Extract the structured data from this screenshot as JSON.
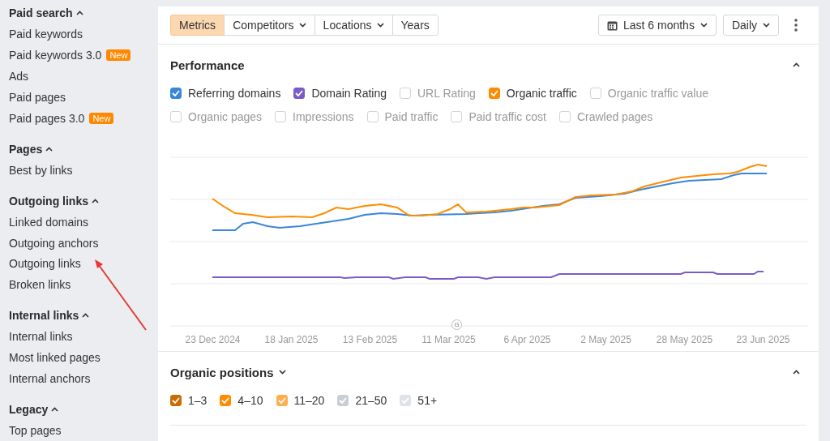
{
  "sidebar": {
    "sections": [
      {
        "title": "Paid search",
        "expanded": true,
        "items": [
          {
            "label": "Paid keywords"
          },
          {
            "label": "Paid keywords 3.0",
            "badge": "New"
          },
          {
            "label": "Ads"
          },
          {
            "label": "Paid pages"
          },
          {
            "label": "Paid pages 3.0",
            "badge": "New"
          }
        ]
      },
      {
        "title": "Pages",
        "expanded": true,
        "items": [
          {
            "label": "Best by links"
          }
        ]
      },
      {
        "title": "Outgoing links",
        "expanded": true,
        "items": [
          {
            "label": "Linked domains"
          },
          {
            "label": "Outgoing anchors"
          },
          {
            "label": "Outgoing links"
          },
          {
            "label": "Broken links"
          }
        ]
      },
      {
        "title": "Internal links",
        "expanded": true,
        "items": [
          {
            "label": "Internal links"
          },
          {
            "label": "Most linked pages"
          },
          {
            "label": "Internal anchors"
          }
        ]
      },
      {
        "title": "Legacy",
        "expanded": true,
        "items": [
          {
            "label": "Top pages"
          }
        ]
      }
    ]
  },
  "toolbar": {
    "tabs": [
      {
        "label": "Metrics",
        "selected": true,
        "dropdown": false
      },
      {
        "label": "Competitors",
        "selected": false,
        "dropdown": true
      },
      {
        "label": "Locations",
        "selected": false,
        "dropdown": true
      },
      {
        "label": "Years",
        "selected": false,
        "dropdown": false
      }
    ],
    "period": "Last 6 months",
    "interval": "Daily"
  },
  "performance": {
    "title": "Performance",
    "expanded": true,
    "metrics": [
      {
        "label": "Referring domains",
        "checked": true,
        "color": "#3a86d8"
      },
      {
        "label": "Domain Rating",
        "checked": true,
        "color": "#7a5cc8"
      },
      {
        "label": "URL Rating",
        "checked": false
      },
      {
        "label": "Organic traffic",
        "checked": true,
        "color": "#ff8c00"
      },
      {
        "label": "Organic traffic value",
        "checked": false
      },
      {
        "label": "Organic pages",
        "checked": false
      },
      {
        "label": "Impressions",
        "checked": false
      },
      {
        "label": "Paid traffic",
        "checked": false
      },
      {
        "label": "Paid traffic cost",
        "checked": false
      },
      {
        "label": "Crawled pages",
        "checked": false
      }
    ],
    "x_labels": [
      "23 Dec 2024",
      "18 Jan 2025",
      "13 Feb 2025",
      "11 Mar 2025",
      "6 Apr 2025",
      "2 May 2025",
      "28 May 2025",
      "23 Jun 2025"
    ],
    "marker": "G"
  },
  "organic_positions": {
    "title": "Organic positions",
    "expanded": true,
    "ranges": [
      {
        "label": "1–3",
        "checked": true,
        "color": "#c86b00"
      },
      {
        "label": "4–10",
        "checked": true,
        "color": "#ff8c00"
      },
      {
        "label": "11–20",
        "checked": true,
        "color": "#ffad4d"
      },
      {
        "label": "21–50",
        "checked": true,
        "color": "#c9ced6"
      },
      {
        "label": "51+",
        "checked": true,
        "color": "#dfe2e7"
      }
    ]
  }
}
